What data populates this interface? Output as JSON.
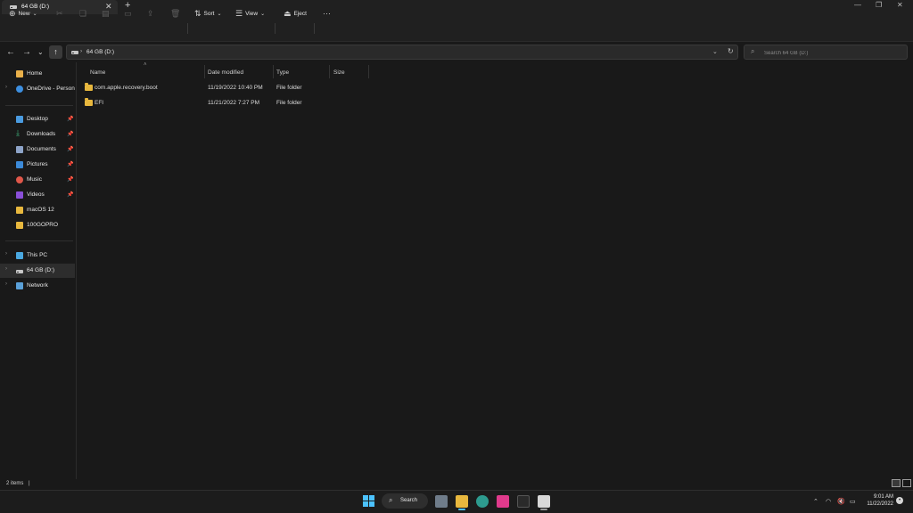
{
  "window": {
    "tab_title": "64 GB (D:)",
    "new_tab": "+",
    "close_tab": "✕",
    "minimize": "—",
    "maximize": "❐",
    "close": "✕"
  },
  "toolbar": {
    "new_label": "New",
    "sort_label": "Sort",
    "view_label": "View",
    "eject_label": "Eject",
    "more_label": "···"
  },
  "address": {
    "crumb": "64 GB (D:)",
    "search_placeholder": "Search 64 GB (D:)"
  },
  "sidebar": {
    "items": [
      {
        "label": "Home"
      },
      {
        "label": "OneDrive - Persona"
      },
      {
        "label": "Desktop"
      },
      {
        "label": "Downloads"
      },
      {
        "label": "Documents"
      },
      {
        "label": "Pictures"
      },
      {
        "label": "Music"
      },
      {
        "label": "Videos"
      },
      {
        "label": "macOS 12"
      },
      {
        "label": "100GOPRO"
      },
      {
        "label": "This PC"
      },
      {
        "label": "64 GB (D:)"
      },
      {
        "label": "Network"
      }
    ]
  },
  "columns": {
    "name": "Name",
    "date": "Date modified",
    "type": "Type",
    "size": "Size"
  },
  "files": [
    {
      "name": "com.apple.recovery.boot",
      "date": "11/19/2022 10:40 PM",
      "type": "File folder",
      "size": ""
    },
    {
      "name": "EFI",
      "date": "11/21/2022 7:27 PM",
      "type": "File folder",
      "size": ""
    }
  ],
  "status": {
    "count": "2 items",
    "separator": "|"
  },
  "taskbar": {
    "search_label": "Search",
    "time": "9:01 AM",
    "date": "11/22/2022"
  },
  "colors": {
    "background": "#191919",
    "folder": "#e8b83e",
    "accent": "#4cc2ff"
  }
}
